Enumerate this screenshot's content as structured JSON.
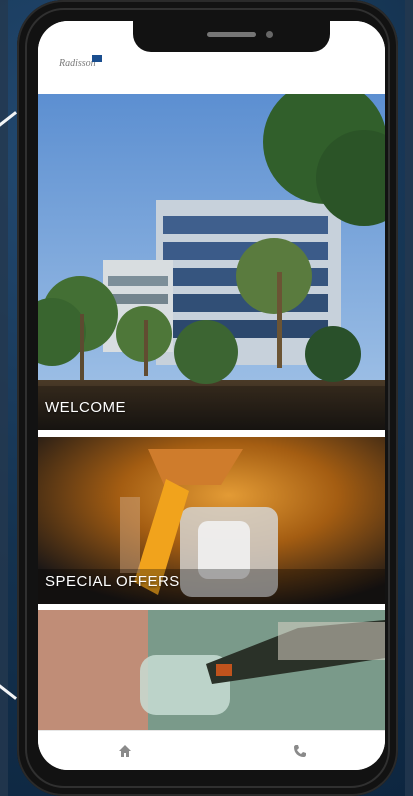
{
  "app": {
    "logo_text": "Radisson",
    "brand_color": "#1a4e8f"
  },
  "cards": [
    {
      "label": "WELCOME",
      "image": "hotel-building-with-palm-trees"
    },
    {
      "label": "SPECIAL OFFERS",
      "image": "pouring-drink-with-orange-peel"
    },
    {
      "label": "",
      "image": "bottle-pouring-into-glass"
    }
  ],
  "nav": {
    "home_icon": "home-icon",
    "phone_icon": "phone-icon"
  }
}
